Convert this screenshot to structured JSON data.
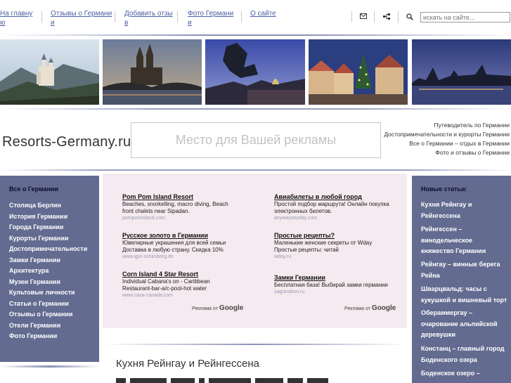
{
  "nav": {
    "home": [
      "На главну",
      "ю"
    ],
    "reviews": [
      "Отзывы о Германи",
      "и"
    ],
    "add_review": [
      "Добавить отзы",
      "в"
    ],
    "photos": [
      "Фото Германи",
      "и"
    ],
    "about": "О сайте"
  },
  "search": {
    "placeholder": "искать на сайте..."
  },
  "icons": {
    "mail": "mail-icon",
    "sitemap": "sitemap-icon",
    "search": "search-icon"
  },
  "header": {
    "site_title": "Resorts-Germany.ru",
    "ad_placeholder": "Место для Вашей рекламы",
    "links": [
      "Путеводитель по Германии",
      "Достопримечательности и курорты Германии",
      "Все о Германии – отдых в Германии",
      "Фото и отзывы о Германии"
    ]
  },
  "left_sidebar": {
    "title": "Все о Германии",
    "items": [
      "Столица Берлин",
      "История Германии",
      "Города Германии",
      "Курорты Германии",
      "Достопримечательности",
      "Замки Германии",
      "Архитектура",
      "Музеи Германии",
      "Культовые личности",
      "Статьи о Германии",
      "Отзывы о Германии",
      "Отели Германии",
      "Фото Германии"
    ]
  },
  "ads_left": [
    {
      "title": "Pom Pom Island Resort",
      "desc": [
        "Beaches, snorkelling, macro diving, Beach",
        "front chalets near Sipadan."
      ],
      "url": "pompomisland.com"
    },
    {
      "title": "Русское золото в Германии",
      "desc": [
        "Ювелирные украшения для всей семьи",
        "Доставка в любую страну. Скидка 10%"
      ],
      "url": "www.igor-schimberg.de"
    },
    {
      "title": "Corn Island 4 Star Resort",
      "desc": [
        "Individual Cabana's on - Caribbean",
        "Restaurant-bar-a/c-pool-hot water"
      ],
      "url": "www.casa-canada.com"
    }
  ],
  "ads_right": [
    {
      "title": "Авиабилеты в любой город",
      "desc": [
        "Простой подбор маршрута! Онлайн покупка",
        "электронных билетов."
      ],
      "url": "anywayanyday.com"
    },
    {
      "title": "Простые рецепты?",
      "desc": [
        "Маленькие женские секреты от Wday",
        "Простые рецепты: читай"
      ],
      "url": "wday.ru"
    },
    {
      "title": "Замки Германии",
      "desc": [
        "Бесплатная база! Выбирай замки германии"
      ],
      "url": "zagrandom.ru"
    }
  ],
  "ads_by": {
    "label": "Реклама от",
    "brand": "Google"
  },
  "article": {
    "title": "Кухня Рейнгау и Рейнгессена"
  },
  "right_sidebar": {
    "title": "Новые статьи:",
    "items": [
      [
        "Кухня Рейнгау и",
        "Рейнгессена"
      ],
      [
        "Рейнгессен –",
        "винодельческое",
        "княжество Германии"
      ],
      [
        "Рейнгау – винные берега",
        "Рейна"
      ],
      [
        "Шварцвальд: часы с",
        "кукушкой и вишневый торт"
      ],
      [
        "Обераммергау –",
        "очарование альпийской",
        "деревушки"
      ],
      [
        "Констанц – главный город",
        "Боденского озера"
      ],
      [
        "Боденское озеро –"
      ]
    ]
  }
}
